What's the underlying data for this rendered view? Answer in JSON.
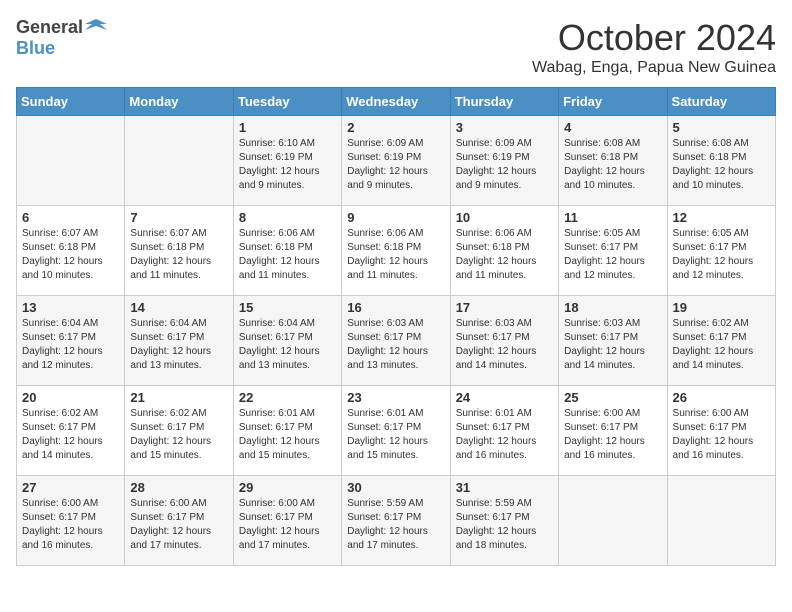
{
  "logo": {
    "text_general": "General",
    "text_blue": "Blue"
  },
  "title": "October 2024",
  "subtitle": "Wabag, Enga, Papua New Guinea",
  "weekdays": [
    "Sunday",
    "Monday",
    "Tuesday",
    "Wednesday",
    "Thursday",
    "Friday",
    "Saturday"
  ],
  "weeks": [
    [
      {
        "day": "",
        "info": ""
      },
      {
        "day": "",
        "info": ""
      },
      {
        "day": "1",
        "info": "Sunrise: 6:10 AM\nSunset: 6:19 PM\nDaylight: 12 hours and 9 minutes."
      },
      {
        "day": "2",
        "info": "Sunrise: 6:09 AM\nSunset: 6:19 PM\nDaylight: 12 hours and 9 minutes."
      },
      {
        "day": "3",
        "info": "Sunrise: 6:09 AM\nSunset: 6:19 PM\nDaylight: 12 hours and 9 minutes."
      },
      {
        "day": "4",
        "info": "Sunrise: 6:08 AM\nSunset: 6:18 PM\nDaylight: 12 hours and 10 minutes."
      },
      {
        "day": "5",
        "info": "Sunrise: 6:08 AM\nSunset: 6:18 PM\nDaylight: 12 hours and 10 minutes."
      }
    ],
    [
      {
        "day": "6",
        "info": "Sunrise: 6:07 AM\nSunset: 6:18 PM\nDaylight: 12 hours and 10 minutes."
      },
      {
        "day": "7",
        "info": "Sunrise: 6:07 AM\nSunset: 6:18 PM\nDaylight: 12 hours and 11 minutes."
      },
      {
        "day": "8",
        "info": "Sunrise: 6:06 AM\nSunset: 6:18 PM\nDaylight: 12 hours and 11 minutes."
      },
      {
        "day": "9",
        "info": "Sunrise: 6:06 AM\nSunset: 6:18 PM\nDaylight: 12 hours and 11 minutes."
      },
      {
        "day": "10",
        "info": "Sunrise: 6:06 AM\nSunset: 6:18 PM\nDaylight: 12 hours and 11 minutes."
      },
      {
        "day": "11",
        "info": "Sunrise: 6:05 AM\nSunset: 6:17 PM\nDaylight: 12 hours and 12 minutes."
      },
      {
        "day": "12",
        "info": "Sunrise: 6:05 AM\nSunset: 6:17 PM\nDaylight: 12 hours and 12 minutes."
      }
    ],
    [
      {
        "day": "13",
        "info": "Sunrise: 6:04 AM\nSunset: 6:17 PM\nDaylight: 12 hours and 12 minutes."
      },
      {
        "day": "14",
        "info": "Sunrise: 6:04 AM\nSunset: 6:17 PM\nDaylight: 12 hours and 13 minutes."
      },
      {
        "day": "15",
        "info": "Sunrise: 6:04 AM\nSunset: 6:17 PM\nDaylight: 12 hours and 13 minutes."
      },
      {
        "day": "16",
        "info": "Sunrise: 6:03 AM\nSunset: 6:17 PM\nDaylight: 12 hours and 13 minutes."
      },
      {
        "day": "17",
        "info": "Sunrise: 6:03 AM\nSunset: 6:17 PM\nDaylight: 12 hours and 14 minutes."
      },
      {
        "day": "18",
        "info": "Sunrise: 6:03 AM\nSunset: 6:17 PM\nDaylight: 12 hours and 14 minutes."
      },
      {
        "day": "19",
        "info": "Sunrise: 6:02 AM\nSunset: 6:17 PM\nDaylight: 12 hours and 14 minutes."
      }
    ],
    [
      {
        "day": "20",
        "info": "Sunrise: 6:02 AM\nSunset: 6:17 PM\nDaylight: 12 hours and 14 minutes."
      },
      {
        "day": "21",
        "info": "Sunrise: 6:02 AM\nSunset: 6:17 PM\nDaylight: 12 hours and 15 minutes."
      },
      {
        "day": "22",
        "info": "Sunrise: 6:01 AM\nSunset: 6:17 PM\nDaylight: 12 hours and 15 minutes."
      },
      {
        "day": "23",
        "info": "Sunrise: 6:01 AM\nSunset: 6:17 PM\nDaylight: 12 hours and 15 minutes."
      },
      {
        "day": "24",
        "info": "Sunrise: 6:01 AM\nSunset: 6:17 PM\nDaylight: 12 hours and 16 minutes."
      },
      {
        "day": "25",
        "info": "Sunrise: 6:00 AM\nSunset: 6:17 PM\nDaylight: 12 hours and 16 minutes."
      },
      {
        "day": "26",
        "info": "Sunrise: 6:00 AM\nSunset: 6:17 PM\nDaylight: 12 hours and 16 minutes."
      }
    ],
    [
      {
        "day": "27",
        "info": "Sunrise: 6:00 AM\nSunset: 6:17 PM\nDaylight: 12 hours and 16 minutes."
      },
      {
        "day": "28",
        "info": "Sunrise: 6:00 AM\nSunset: 6:17 PM\nDaylight: 12 hours and 17 minutes."
      },
      {
        "day": "29",
        "info": "Sunrise: 6:00 AM\nSunset: 6:17 PM\nDaylight: 12 hours and 17 minutes."
      },
      {
        "day": "30",
        "info": "Sunrise: 5:59 AM\nSunset: 6:17 PM\nDaylight: 12 hours and 17 minutes."
      },
      {
        "day": "31",
        "info": "Sunrise: 5:59 AM\nSunset: 6:17 PM\nDaylight: 12 hours and 18 minutes."
      },
      {
        "day": "",
        "info": ""
      },
      {
        "day": "",
        "info": ""
      }
    ]
  ]
}
